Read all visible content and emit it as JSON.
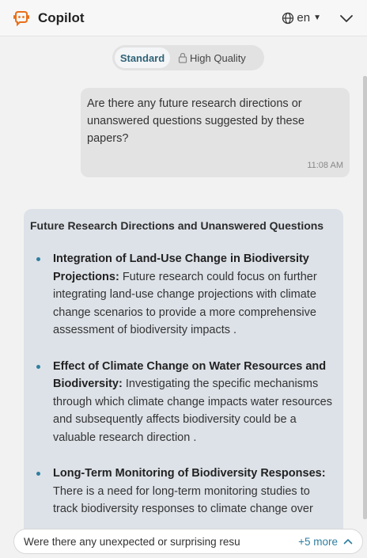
{
  "header": {
    "title": "Copilot",
    "language": "en",
    "icons": {
      "logo": "copilot-logo-icon",
      "globe": "globe-icon",
      "caret": "caret-down-icon",
      "collapse": "chevron-down-icon"
    }
  },
  "mode": {
    "standard_label": "Standard",
    "high_quality_label": "High Quality",
    "selected": "Standard",
    "lock_icon": "lock-icon"
  },
  "user_message": {
    "text": "Are there any future research directions or unanswered questions suggested by these papers?",
    "time": "11:08 AM"
  },
  "bot_message": {
    "title": "Future Research Directions and Unanswered Questions",
    "items": [
      {
        "heading": "Integration of Land-Use Change in Biodiversity Projections:",
        "body": " Future research could focus on further integrating land-use change projections with climate change scenarios to provide a more comprehensive assessment of biodiversity impacts ."
      },
      {
        "heading": "Effect of Climate Change on Water Resources and Biodiversity:",
        "body": " Investigating the specific mechanisms through which climate change impacts water resources and subsequently affects biodiversity could be a valuable research direction ."
      },
      {
        "heading": "Long-Term Monitoring of Biodiversity Responses:",
        "body": " There is a need for long-term monitoring studies to track biodiversity responses to climate change over"
      }
    ]
  },
  "suggestion": {
    "text": "Were there any unexpected or surprising resu",
    "more_label": "+5 more",
    "expand_icon": "chevron-up-icon"
  },
  "colors": {
    "accent": "#2f7ea0",
    "logo": "#e8701a"
  }
}
